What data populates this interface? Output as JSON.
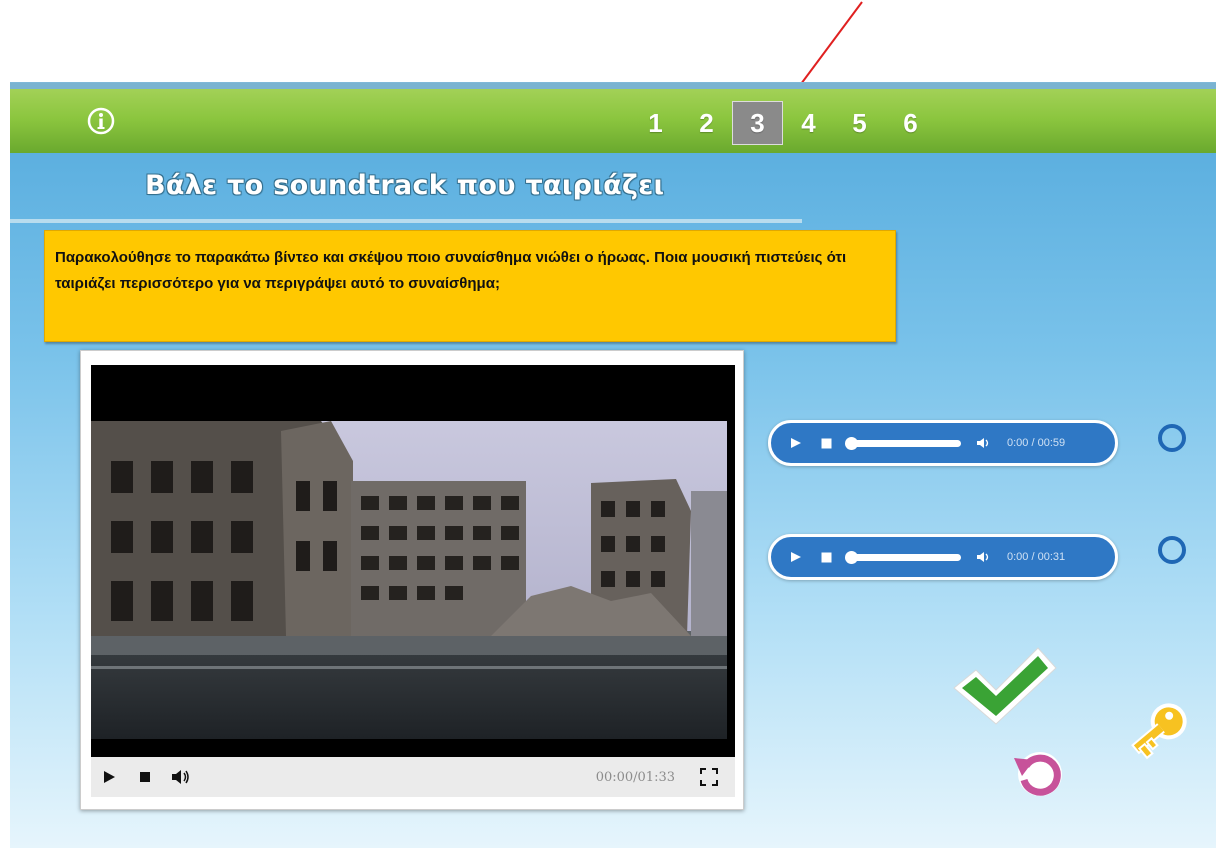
{
  "nav": {
    "info_icon": "info-circle-icon",
    "items": [
      "1",
      "2",
      "3",
      "4",
      "5",
      "6"
    ],
    "active": "3",
    "annotation_color": "#e02020"
  },
  "header": {
    "title": "Βάλε το soundtrack που ταιριάζει"
  },
  "instruction": {
    "text": "Παρακολούθησε το παρακάτω βίντεο και σκέψου ποιο συναίσθημα νιώθει ο ήρωας. Ποια μουσική πιστεύεις ότι ταιριάζει περισσότερο για να περιγράψει αυτό το συναίσθημα;"
  },
  "video": {
    "time": "00:00/01:33",
    "icons": [
      "play-icon",
      "stop-icon",
      "volume-icon",
      "fullscreen-icon"
    ]
  },
  "audio_options": [
    {
      "time": "0:00 / 00:59",
      "progress": 0
    },
    {
      "time": "0:00 / 00:31",
      "progress": 0
    }
  ],
  "actions": {
    "check_icon": "checkmark-icon",
    "reset_icon": "reset-icon",
    "key_icon": "key-icon"
  },
  "colors": {
    "topbar": "#8cc63f",
    "instruction_bg": "#ffc800",
    "audio_bg": "#2f78c5",
    "radio": "#1f67b5"
  }
}
